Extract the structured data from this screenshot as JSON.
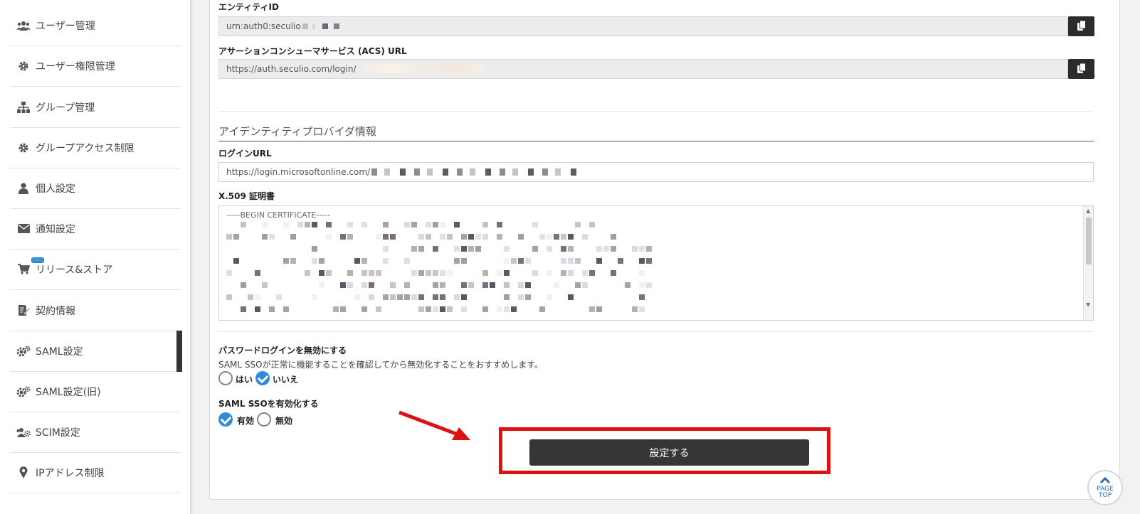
{
  "sidebar": {
    "items": [
      {
        "label": "ユーザー管理",
        "icon": "users-icon"
      },
      {
        "label": "ユーザー権限管理",
        "icon": "gear-icon"
      },
      {
        "label": "グループ管理",
        "icon": "sitemap-icon"
      },
      {
        "label": "グループアクセス制限",
        "icon": "gear-icon"
      },
      {
        "label": "個人設定",
        "icon": "user-icon"
      },
      {
        "label": "通知設定",
        "icon": "envelope-icon"
      },
      {
        "label": "リリース&ストア",
        "icon": "cart-icon"
      },
      {
        "label": "契約情報",
        "icon": "contract-edit-icon"
      },
      {
        "label": "SAML設定",
        "icon": "gears-icon"
      },
      {
        "label": "SAML設定(旧)",
        "icon": "gears-icon"
      },
      {
        "label": "SCIM設定",
        "icon": "users-gear-icon"
      },
      {
        "label": "IPアドレス制限",
        "icon": "map-pin-icon"
      }
    ],
    "active": "SAML設定"
  },
  "sp_info": {
    "entity_id_label": "エンティティID",
    "entity_id_value": "urn:auth0:seculio",
    "acs_label": "アサーションコンシューマサービス (ACS) URL",
    "acs_value": "https://auth.seculio.com/login/"
  },
  "idp": {
    "section_title": "アイデンティティプロバイダ情報",
    "login_url_label": "ログインURL",
    "login_url_value": "https://login.microsoftonline.com/",
    "cert_label": "X.509 証明書",
    "cert_first_line": "-----BEGIN CERTIFICATE-----"
  },
  "password_login": {
    "label": "パスワードログインを無効にする",
    "help": "SAML SSOが正常に機能することを確認してから無効化することをおすすめします。",
    "options": [
      "はい",
      "いいえ"
    ],
    "selected": "いいえ"
  },
  "saml_sso": {
    "label": "SAML SSOを有効化する",
    "options": [
      "有効",
      "無効"
    ],
    "selected": "有効"
  },
  "submit_label": "設定する",
  "pagetop": {
    "line1": "PAGE",
    "line2": "TOP"
  },
  "colors": {
    "accent": "#2f8bd8",
    "highlight": "#dd1111",
    "button": "#363636"
  }
}
